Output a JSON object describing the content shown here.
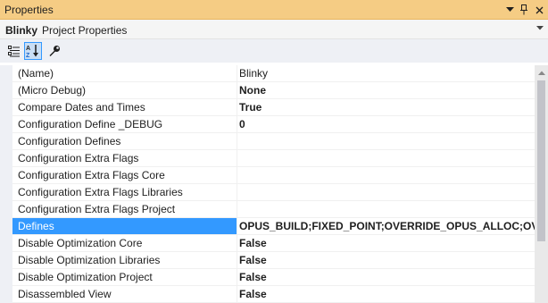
{
  "window": {
    "title": "Properties",
    "icons": [
      "chevron-down-icon",
      "pin-icon",
      "close-icon"
    ]
  },
  "object": {
    "name": "Blinky",
    "type": "Project Properties"
  },
  "toolbar": {
    "buttons": [
      "categorized-icon",
      "alphabetical-icon",
      "property-pages-icon"
    ],
    "active": "alphabetical-icon"
  },
  "properties": [
    {
      "name": "(Name)",
      "value": "Blinky",
      "bold": false
    },
    {
      "name": "(Micro Debug)",
      "value": "None",
      "bold": true
    },
    {
      "name": "Compare Dates and Times",
      "value": "True",
      "bold": true
    },
    {
      "name": "Configuration Define _DEBUG",
      "value": "0",
      "bold": true
    },
    {
      "name": "Configuration Defines",
      "value": "",
      "bold": false
    },
    {
      "name": "Configuration Extra Flags",
      "value": "",
      "bold": false
    },
    {
      "name": "Configuration Extra Flags Core",
      "value": "",
      "bold": false
    },
    {
      "name": "Configuration Extra Flags Libraries",
      "value": "",
      "bold": false
    },
    {
      "name": "Configuration Extra Flags Project",
      "value": "",
      "bold": false
    },
    {
      "name": "Defines",
      "value": "OPUS_BUILD;FIXED_POINT;OVERRIDE_OPUS_ALLOC;OVERR",
      "bold": true,
      "selected": true
    },
    {
      "name": "Disable Optimization Core",
      "value": "False",
      "bold": true
    },
    {
      "name": "Disable Optimization Libraries",
      "value": "False",
      "bold": true
    },
    {
      "name": "Disable Optimization Project",
      "value": "False",
      "bold": true
    },
    {
      "name": "Disassembled View",
      "value": "False",
      "bold": true
    }
  ],
  "colors": {
    "title_bar": "#f5cc84",
    "selection": "#3399ff",
    "toolbar": "#eef0f5"
  }
}
